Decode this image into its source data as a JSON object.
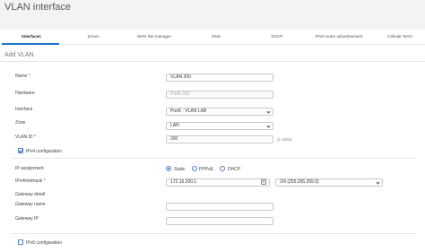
{
  "header": {
    "title": "VLAN interface"
  },
  "tabs": [
    {
      "label": "Interfaces",
      "active": true
    },
    {
      "label": "Zones",
      "active": false
    },
    {
      "label": "WAN link manager",
      "active": false
    },
    {
      "label": "DNS",
      "active": false
    },
    {
      "label": "DHCP",
      "active": false
    },
    {
      "label": "IPv6 router advertisement",
      "active": false
    },
    {
      "label": "Cellular WAN",
      "active": false
    }
  ],
  "section": {
    "title": "Add VLAN"
  },
  "form": {
    "name": {
      "label": "Name *",
      "value": "VLAN 200"
    },
    "hardware": {
      "label": "Hardware",
      "value": "Port6.200"
    },
    "interface": {
      "label": "Interface",
      "value": "Port6 - VLAN LAB"
    },
    "zone": {
      "label": "Zone",
      "value": "LAN"
    },
    "vlan_id": {
      "label": "VLAN ID *",
      "value": "200",
      "hint": "[1-4094]"
    },
    "ipv4_config": {
      "label": "IPv4 configuration",
      "checked": true
    },
    "ip_assignment": {
      "label": "IP assignment",
      "options": [
        {
          "label": "Static",
          "selected": true
        },
        {
          "label": "PPPoE",
          "selected": false
        },
        {
          "label": "DHCP",
          "selected": false
        }
      ]
    },
    "ipv4_netmask": {
      "label": "IPv4/netmask *",
      "ip_value": "172.16.200.1",
      "netmask_value": "/24 (255.255.255.0)"
    },
    "gateway_detail": {
      "label": "Gateway detail"
    },
    "gateway_name": {
      "label": "Gateway name",
      "value": ""
    },
    "gateway_ip": {
      "label": "Gateway IP",
      "value": ""
    },
    "ipv6_config": {
      "label": "IPv6 configuration",
      "checked": false
    }
  },
  "colors": {
    "accent": "#1a73c8",
    "header_bg": "#f3f3f3"
  }
}
